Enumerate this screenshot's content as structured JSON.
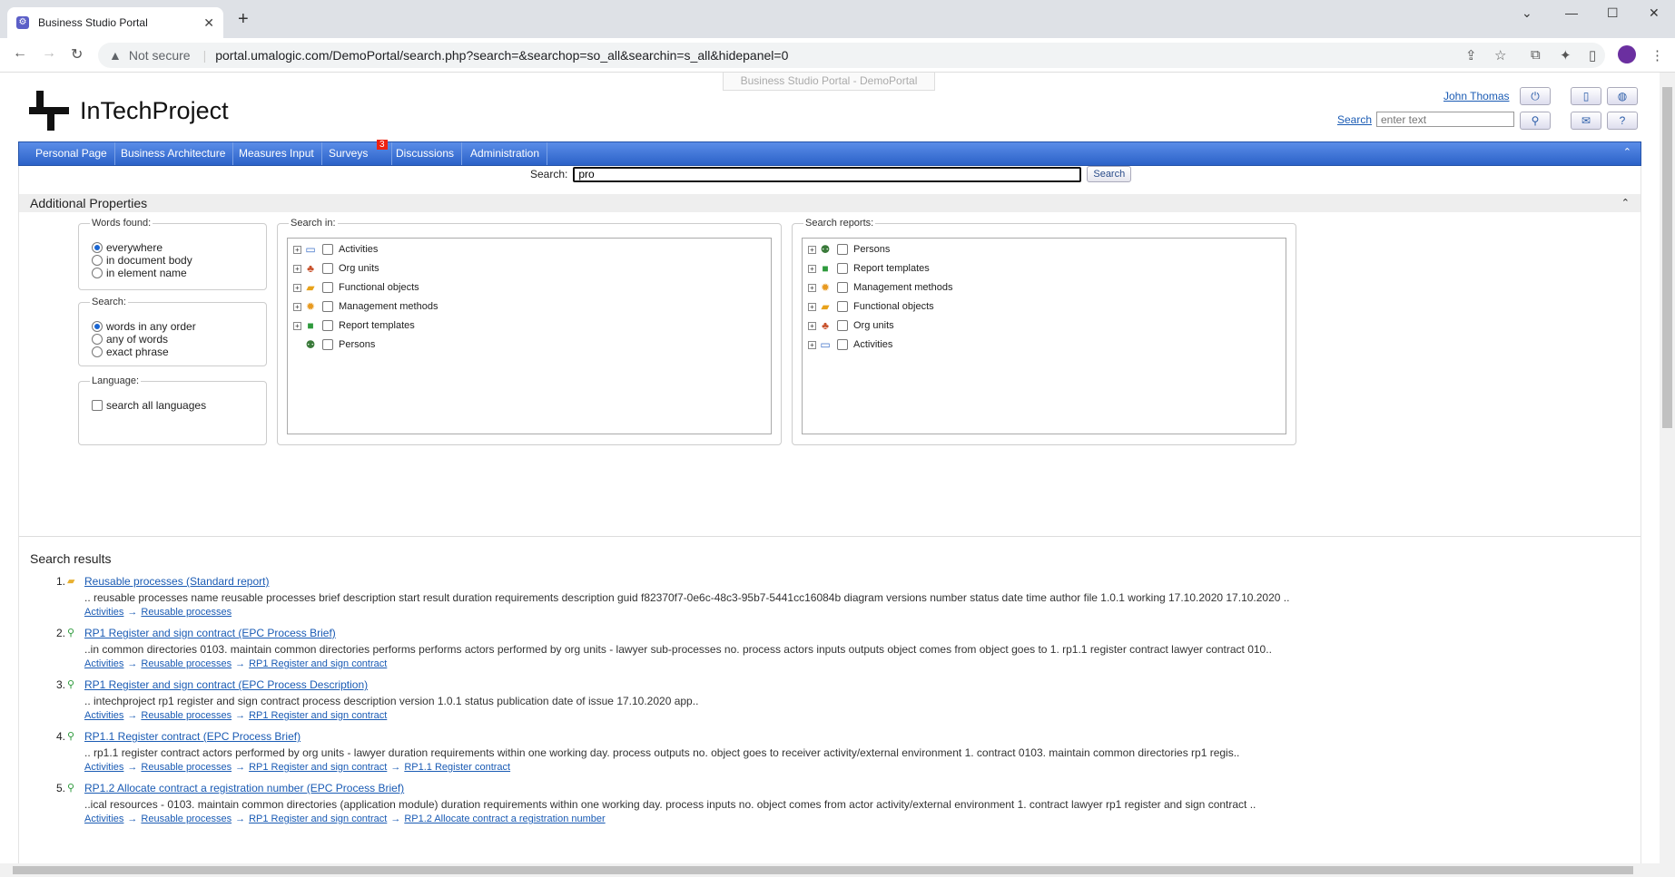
{
  "browser": {
    "tab_title": "Business Studio Portal",
    "not_secure": "Not secure",
    "url": "portal.umalogic.com/DemoPortal/search.php?search=&searchop=so_all&searchin=s_all&hidepanel=0"
  },
  "header": {
    "portal_tag": "Business Studio Portal - DemoPortal",
    "logo_text": "InTechProject",
    "user_name": "John Thomas",
    "search_link": "Search",
    "search_placeholder": "enter text"
  },
  "menu": {
    "items": [
      "Personal Page",
      "Business Architecture",
      "Measures Input",
      "Surveys",
      "Discussions",
      "Administration"
    ],
    "surveys_badge": "3"
  },
  "search": {
    "label": "Search:",
    "value": "pro",
    "button": "Search"
  },
  "additional": {
    "title": "Additional Properties",
    "words_found": {
      "legend": "Words found:",
      "options": [
        "everywhere",
        "in document body",
        "in element name"
      ],
      "selected": "everywhere"
    },
    "search_mode": {
      "legend": "Search:",
      "options": [
        "words in any order",
        "any of words",
        "exact phrase"
      ],
      "selected": "words in any order"
    },
    "language": {
      "legend": "Language:",
      "checkbox": "search all languages"
    },
    "search_in": {
      "legend": "Search in:",
      "items": [
        "Activities",
        "Org units",
        "Functional objects",
        "Management methods",
        "Report templates",
        "Persons"
      ]
    },
    "search_reports": {
      "legend": "Search reports:",
      "items": [
        "Persons",
        "Report templates",
        "Management methods",
        "Functional objects",
        "Org units",
        "Activities"
      ]
    }
  },
  "results": {
    "title": "Search results",
    "items": [
      {
        "num": "1.",
        "title": "Reusable processes (Standard report)",
        "snippet": ".. reusable processes name reusable processes brief description start result duration requirements description guid f82370f7-0e6c-48c3-95b7-5441cc16084b diagram versions number status date time author file 1.0.1 working 17.10.2020 17.10.2020 ..",
        "crumbs": [
          "Activities",
          "Reusable processes"
        ]
      },
      {
        "num": "2.",
        "title": "RP1 Register and sign contract (EPC Process Brief)",
        "snippet": "..in common directories 0103. maintain common directories performs performs actors performed by org units - lawyer    sub-processes no. process actors inputs outputs object comes from object goes to 1. rp1.1 register contract lawyer contract 010..",
        "crumbs": [
          "Activities",
          "Reusable processes",
          "RP1 Register and sign contract"
        ]
      },
      {
        "num": "3.",
        "title": "RP1 Register and sign contract (EPC Process Description)",
        "snippet": ".. intechproject                                                                    rp1 register and sign contract process description version 1.0.1 status publication date of issue 17.10.2020 app..",
        "crumbs": [
          "Activities",
          "Reusable processes",
          "RP1 Register and sign contract"
        ]
      },
      {
        "num": "4.",
        "title": "RP1.1 Register contract (EPC Process Brief)",
        "snippet": ".. rp1.1 register contract actors performed by org units - lawyer  duration requirements within one working day.    process outputs no. object goes to receiver activity/external environment 1. contract 0103. maintain common directories rp1 regis..",
        "crumbs": [
          "Activities",
          "Reusable processes",
          "RP1 Register and sign contract",
          "RP1.1 Register contract"
        ]
      },
      {
        "num": "5.",
        "title": "RP1.2 Allocate contract a registration number (EPC Process Brief)",
        "snippet": "..ical resources - 0103. maintain common directories (application module) duration requirements within one working day.    process inputs no. object comes from actor activity/external environment 1. contract lawyer rp1 register and sign contract ..",
        "crumbs": [
          "Activities",
          "Reusable processes",
          "RP1 Register and sign contract",
          "RP1.2 Allocate contract a registration number"
        ]
      }
    ]
  }
}
